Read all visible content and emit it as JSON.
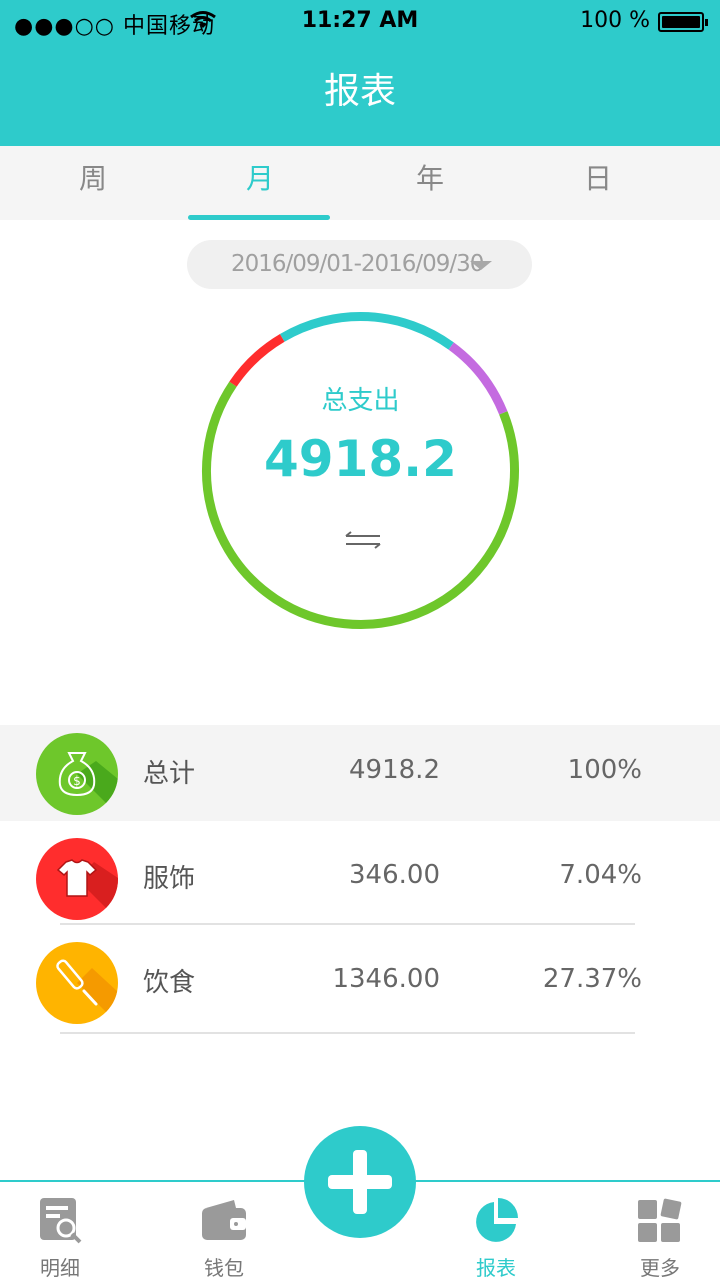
{
  "status_bar": {
    "carrier": "●●●○○ 中国移动",
    "time": "11:27 AM",
    "battery": "100 %"
  },
  "header": {
    "title": "报表"
  },
  "tabs": [
    {
      "label": "周",
      "active": false
    },
    {
      "label": "月",
      "active": true
    },
    {
      "label": "年",
      "active": false
    },
    {
      "label": "日",
      "active": false
    }
  ],
  "date_range": "2016/09/01-2016/09/30",
  "summary": {
    "label": "总支出",
    "value": "4918.2"
  },
  "chart_data": {
    "type": "pie",
    "segments": [
      {
        "color": "#6ec72b",
        "percent": 65.59
      },
      {
        "color": "#ff2d2d",
        "percent": 7.04
      },
      {
        "color": "#2ecbcb",
        "percent": 18.5
      },
      {
        "color": "#c46be0",
        "percent": 8.87
      }
    ]
  },
  "rows": [
    {
      "name": "总计",
      "amount": "4918.2",
      "percent": "100%",
      "icon": "money-bag-icon",
      "color": "#6ec72b"
    },
    {
      "name": "服饰",
      "amount": "346.00",
      "percent": "7.04%",
      "icon": "shirt-icon",
      "color": "#ff2d2d"
    },
    {
      "name": "饮食",
      "amount": "1346.00",
      "percent": "27.37%",
      "icon": "utensil-icon",
      "color": "#ffb400"
    }
  ],
  "tabbar": [
    {
      "label": "明细",
      "icon": "detail-search-icon",
      "active": false
    },
    {
      "label": "钱包",
      "icon": "wallet-icon",
      "active": false
    },
    {
      "label": "报表",
      "icon": "pie-chart-icon",
      "active": true
    },
    {
      "label": "更多",
      "icon": "grid-more-icon",
      "active": false
    }
  ],
  "colors": {
    "accent": "#2ecbcb"
  }
}
